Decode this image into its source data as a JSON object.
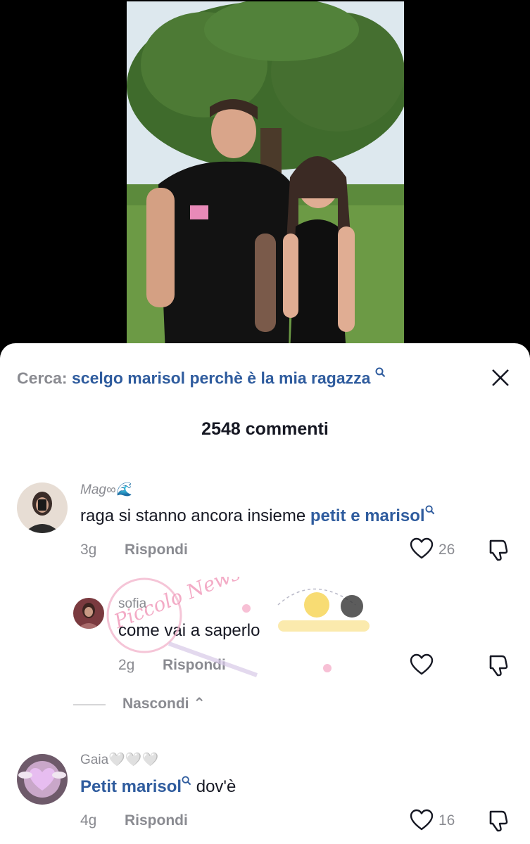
{
  "search": {
    "prefix": "Cerca:",
    "query": "scelgo marisol perchè è la mia ragazza",
    "icon": "search-icon"
  },
  "close": {
    "icon": "close-icon"
  },
  "comments_header": {
    "count_label": "2548 commenti"
  },
  "comments": [
    {
      "username": "Mag∞🌊",
      "text_before": "raga si stanno ancora insieme ",
      "tag": "petit e marisol",
      "time": "3g",
      "reply_label": "Rispondi",
      "likes": "26"
    },
    {
      "username": "sofia",
      "text": "come vai a saperlo",
      "time": "2g",
      "reply_label": "Rispondi",
      "likes": ""
    },
    {
      "username": "Gaia🤍🤍🤍",
      "tag": "Petit marisol",
      "text_after": " dov'è",
      "time": "4g",
      "reply_label": "Rispondi",
      "likes": "16"
    }
  ],
  "replies_toggle": {
    "label": "Nascondi ⌃"
  },
  "watermark": {
    "text": "Piccolo News"
  },
  "colors": {
    "accent": "#2f5c9e",
    "muted": "#8a8b91",
    "text": "#161823"
  }
}
